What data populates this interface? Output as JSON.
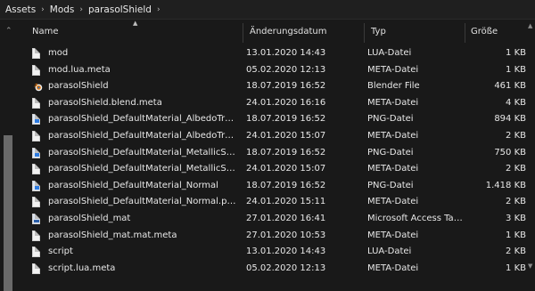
{
  "breadcrumb": [
    "Assets",
    "Mods",
    "parasolShield"
  ],
  "breadcrumb_sep_icon": "chevron-right-icon",
  "columns": {
    "name": "Name",
    "date": "Änderungsdatum",
    "type": "Typ",
    "size": "Größe"
  },
  "files": [
    {
      "name": "mod",
      "date": "13.01.2020 14:43",
      "type": "LUA-Datei",
      "size": "1 KB",
      "icon": "document-icon"
    },
    {
      "name": "mod.lua.meta",
      "date": "05.02.2020 12:13",
      "type": "META-Datei",
      "size": "1 KB",
      "icon": "document-icon"
    },
    {
      "name": "parasolShield",
      "date": "18.07.2019 16:52",
      "type": "Blender File",
      "size": "461 KB",
      "icon": "blender-icon"
    },
    {
      "name": "parasolShield.blend.meta",
      "date": "24.01.2020 16:16",
      "type": "META-Datei",
      "size": "4 KB",
      "icon": "document-icon"
    },
    {
      "name": "parasolShield_DefaultMaterial_AlbedoTranspare...",
      "date": "18.07.2019 16:52",
      "type": "PNG-Datei",
      "size": "894 KB",
      "icon": "image-icon"
    },
    {
      "name": "parasolShield_DefaultMaterial_AlbedoTranspare...",
      "date": "24.01.2020 15:07",
      "type": "META-Datei",
      "size": "2 KB",
      "icon": "document-icon"
    },
    {
      "name": "parasolShield_DefaultMaterial_MetallicSmoothn...",
      "date": "18.07.2019 16:52",
      "type": "PNG-Datei",
      "size": "750 KB",
      "icon": "image-icon"
    },
    {
      "name": "parasolShield_DefaultMaterial_MetallicSmoothn...",
      "date": "24.01.2020 15:07",
      "type": "META-Datei",
      "size": "2 KB",
      "icon": "document-icon"
    },
    {
      "name": "parasolShield_DefaultMaterial_Normal",
      "date": "18.07.2019 16:52",
      "type": "PNG-Datei",
      "size": "1.418 KB",
      "icon": "image-icon"
    },
    {
      "name": "parasolShield_DefaultMaterial_Normal.png.meta",
      "date": "24.01.2020 15:11",
      "type": "META-Datei",
      "size": "2 KB",
      "icon": "document-icon"
    },
    {
      "name": "parasolShield_mat",
      "date": "27.01.2020 16:41",
      "type": "Microsoft Access Tabl...",
      "size": "3 KB",
      "icon": "access-table-icon"
    },
    {
      "name": "parasolShield_mat.mat.meta",
      "date": "27.01.2020 10:53",
      "type": "META-Datei",
      "size": "1 KB",
      "icon": "document-icon"
    },
    {
      "name": "script",
      "date": "13.01.2020 14:43",
      "type": "LUA-Datei",
      "size": "2 KB",
      "icon": "document-icon"
    },
    {
      "name": "script.lua.meta",
      "date": "05.02.2020 12:13",
      "type": "META-Datei",
      "size": "1 KB",
      "icon": "document-icon"
    }
  ]
}
